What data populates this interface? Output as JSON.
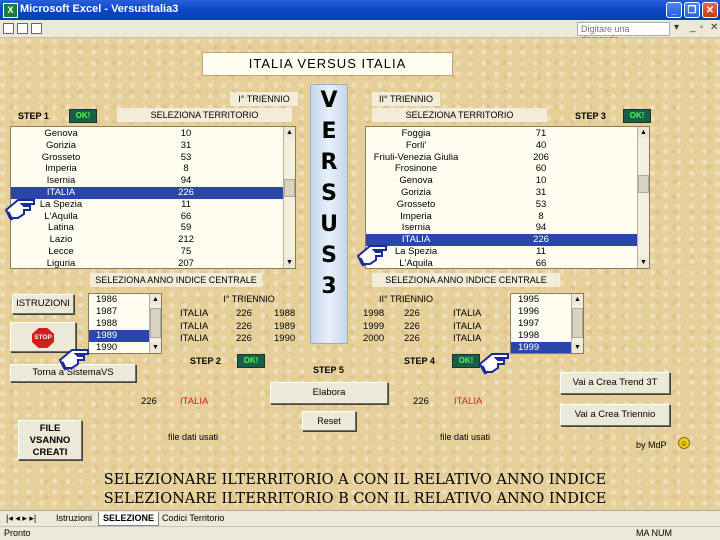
{
  "window": {
    "title": "Microsoft Excel - VersusItalia3",
    "ask_placeholder": "Digitare una domanda."
  },
  "header": {
    "title": "ITALIA VERSUS ITALIA",
    "triennio1": "I° TRIENNIO",
    "triennio2": "II° TRIENNIO"
  },
  "left": {
    "step1": "STEP 1",
    "step2": "STEP 2",
    "ok": "OK!",
    "sel_territorio": "SELEZIONA TERRITORIO",
    "sel_anno": "SELEZIONA ANNO INDICE CENTRALE",
    "territori": [
      {
        "name": "Genova",
        "val": "10"
      },
      {
        "name": "Gorizia",
        "val": "31"
      },
      {
        "name": "Grosseto",
        "val": "53"
      },
      {
        "name": "Imperia",
        "val": "8"
      },
      {
        "name": "Isernia",
        "val": "94"
      },
      {
        "name": "ITALIA",
        "val": "226",
        "sel": true
      },
      {
        "name": "La Spezia",
        "val": "11"
      },
      {
        "name": "L'Aquila",
        "val": "66"
      },
      {
        "name": "Latina",
        "val": "59"
      },
      {
        "name": "Lazio",
        "val": "212"
      },
      {
        "name": "Lecce",
        "val": "75"
      },
      {
        "name": "Liguria",
        "val": "207"
      }
    ],
    "anni": [
      {
        "y": "1986"
      },
      {
        "y": "1987"
      },
      {
        "y": "1988"
      },
      {
        "y": "1989",
        "sel": true
      },
      {
        "y": "1990"
      }
    ],
    "triennio_header": "I° TRIENNIO",
    "rows": [
      {
        "place": "ITALIA",
        "val": "226",
        "year": "1988"
      },
      {
        "place": "ITALIA",
        "val": "226",
        "year": "1989"
      },
      {
        "place": "ITALIA",
        "val": "226",
        "year": "1990"
      }
    ],
    "result_val": "226",
    "result_place": "ITALIA",
    "file_used": "file dati usati"
  },
  "right": {
    "step3": "STEP 3",
    "step4": "STEP 4",
    "ok": "OK!",
    "sel_territorio": "SELEZIONA TERRITORIO",
    "sel_anno": "SELEZIONA ANNO INDICE CENTRALE",
    "territori": [
      {
        "name": "Foggia",
        "val": "71"
      },
      {
        "name": "Forli'",
        "val": "40"
      },
      {
        "name": "Friuli-Venezia Giulia",
        "val": "206"
      },
      {
        "name": "Frosinone",
        "val": "60"
      },
      {
        "name": "Genova",
        "val": "10"
      },
      {
        "name": "Gorizia",
        "val": "31"
      },
      {
        "name": "Grosseto",
        "val": "53"
      },
      {
        "name": "Imperia",
        "val": "8"
      },
      {
        "name": "Isernia",
        "val": "94"
      },
      {
        "name": "ITALIA",
        "val": "226",
        "sel": true
      },
      {
        "name": "La Spezia",
        "val": "11"
      },
      {
        "name": "L'Aquila",
        "val": "66"
      }
    ],
    "anni": [
      {
        "y": "1995"
      },
      {
        "y": "1996"
      },
      {
        "y": "1997"
      },
      {
        "y": "1998"
      },
      {
        "y": "1999",
        "sel": true
      }
    ],
    "triennio_header": "II° TRIENNIO",
    "rows": [
      {
        "year": "1998",
        "val": "226",
        "place": "ITALIA"
      },
      {
        "year": "1999",
        "val": "226",
        "place": "ITALIA"
      },
      {
        "year": "2000",
        "val": "226",
        "place": "ITALIA"
      }
    ],
    "result_val": "226",
    "result_place": "ITALIA",
    "file_used": "file dati usati"
  },
  "versus_letters": [
    "V",
    "E",
    "R",
    "S",
    "U",
    "S",
    "3"
  ],
  "buttons": {
    "istruzioni": "ISTRUZIONI",
    "stop": "STOP",
    "torna": "Torna a SistemaVS",
    "step5": "STEP 5",
    "elabora": "Elabora",
    "reset": "Reset",
    "trend": "Vai a Crea Trend 3T",
    "triennio": "Vai a Crea Triennio",
    "file_line1": "FILE",
    "file_line2": "VSANNO",
    "file_line3": "CREATI"
  },
  "credit": "by MdP",
  "messages": [
    "SELEZIONARE ILTERRITORIO A CON IL RELATIVO ANNO INDICE",
    "SELEZIONARE ILTERRITORIO B CON IL RELATIVO ANNO INDICE"
  ],
  "tabs": [
    {
      "label": "Istruzioni"
    },
    {
      "label": "SELEZIONE",
      "active": true
    },
    {
      "label": "Codici Territorio"
    }
  ],
  "status": {
    "left": "Pronto",
    "right": "MA NUM"
  }
}
